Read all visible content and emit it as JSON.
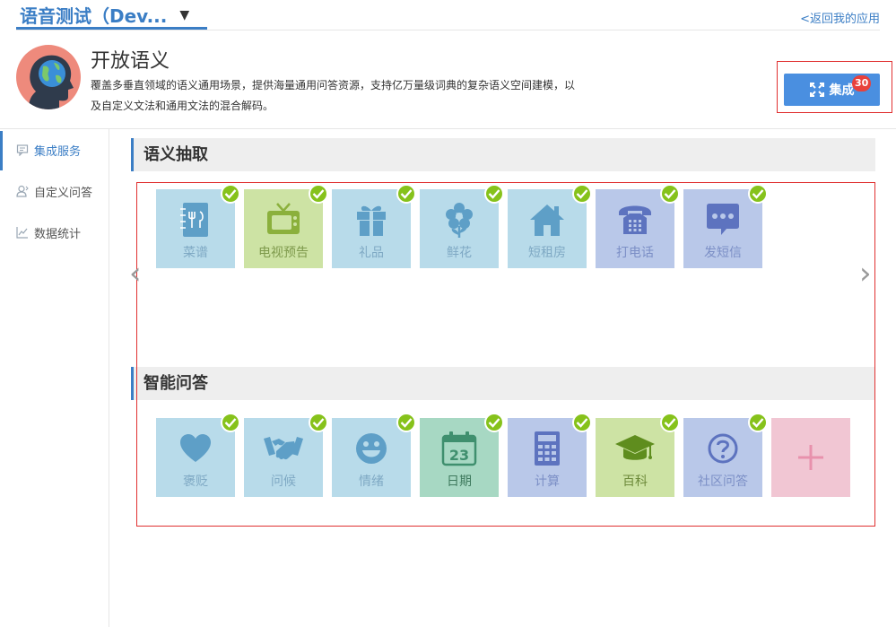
{
  "app": {
    "title": "语音测试（Dev...",
    "back_link": "<返回我的应用"
  },
  "service": {
    "name": "开放语义",
    "description": "覆盖多垂直领域的语义通用场景，提供海量通用问答资源，支持亿万量级词典的复杂语义空间建模，以及自定义文法和通用文法的混合解码。"
  },
  "integrate": {
    "label": "集成",
    "badge": "30"
  },
  "sidebar": {
    "items": [
      {
        "label": "集成服务",
        "icon": "chat-icon"
      },
      {
        "label": "自定义问答",
        "icon": "user-icon"
      },
      {
        "label": "数据统计",
        "icon": "chart-icon"
      }
    ]
  },
  "sections": {
    "extraction": {
      "title": "语义抽取",
      "tiles": [
        {
          "label": "菜谱",
          "icon": "recipe-icon",
          "bg": "#b8dbea",
          "fg": "#5e9fc7",
          "text": "#7fa9c4"
        },
        {
          "label": "电视预告",
          "icon": "tv-icon",
          "bg": "#cde3a4",
          "fg": "#8bb03c",
          "text": "#7e9a4c"
        },
        {
          "label": "礼品",
          "icon": "gift-icon",
          "bg": "#b8dbea",
          "fg": "#5e9fc7",
          "text": "#7fa9c4"
        },
        {
          "label": "鲜花",
          "icon": "flower-icon",
          "bg": "#b8dbea",
          "fg": "#5e9fc7",
          "text": "#7fa9c4"
        },
        {
          "label": "短租房",
          "icon": "house-icon",
          "bg": "#b8dbea",
          "fg": "#5e9fc7",
          "text": "#7fa9c4"
        },
        {
          "label": "打电话",
          "icon": "phone-icon",
          "bg": "#b9c8e9",
          "fg": "#5d73bf",
          "text": "#7c8fc6"
        },
        {
          "label": "发短信",
          "icon": "message-icon",
          "bg": "#b9c8e9",
          "fg": "#5d73bf",
          "text": "#7c8fc6"
        }
      ]
    },
    "qa": {
      "title": "智能问答",
      "tiles": [
        {
          "label": "褒贬",
          "icon": "heart-icon",
          "bg": "#b8dbea",
          "fg": "#5e9fc7",
          "text": "#7fa9c4"
        },
        {
          "label": "问候",
          "icon": "handshake-icon",
          "bg": "#b8dbea",
          "fg": "#5e9fc7",
          "text": "#7fa9c4"
        },
        {
          "label": "情绪",
          "icon": "smiley-icon",
          "bg": "#b8dbea",
          "fg": "#5e9fc7",
          "text": "#7fa9c4"
        },
        {
          "label": "日期",
          "icon": "calendar-icon",
          "bg": "#a7d8c3",
          "fg": "#3f8f6e",
          "text": "#3f7a5e",
          "day": "23"
        },
        {
          "label": "计算",
          "icon": "calculator-icon",
          "bg": "#b9c8e9",
          "fg": "#5d73bf",
          "text": "#7c8fc6"
        },
        {
          "label": "百科",
          "icon": "graduation-cap-icon",
          "bg": "#cde3a4",
          "fg": "#5f8d1e",
          "text": "#6d8a3a"
        },
        {
          "label": "社区问答",
          "icon": "question-icon",
          "bg": "#b9c8e9",
          "fg": "#5d73bf",
          "text": "#7c8fc6"
        }
      ],
      "add_color": "#f1c6d3",
      "add_plus_color": "#e891ac"
    }
  },
  "colors": {
    "accent": "#3b7ec5",
    "button": "#4a8fe0",
    "check": "#86c21b",
    "highlight": "#e03030"
  }
}
